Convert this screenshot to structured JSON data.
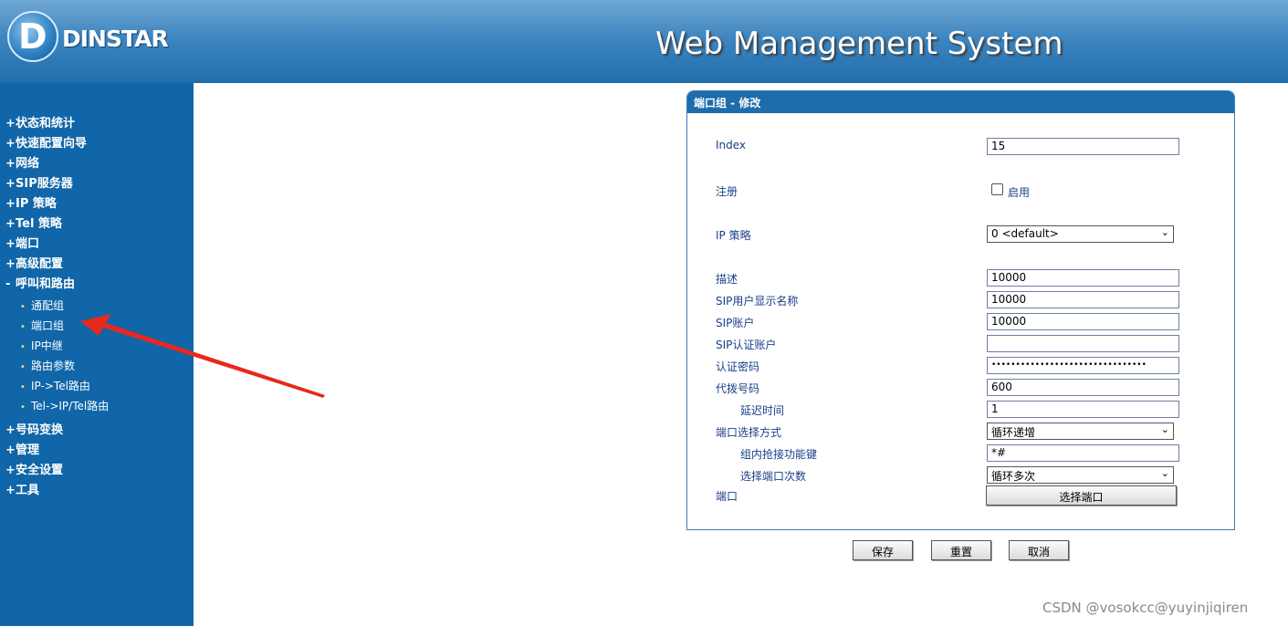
{
  "header": {
    "logo_text": "DINSTAR",
    "logo_mark": "D",
    "system_title": "Web Management System"
  },
  "sidebar": {
    "items": [
      {
        "bullet": "+",
        "label": "状态和统计"
      },
      {
        "bullet": "+",
        "label": "快速配置向导"
      },
      {
        "bullet": "+",
        "label": "网络"
      },
      {
        "bullet": "+",
        "label": "SIP服务器"
      },
      {
        "bullet": "+",
        "label": "IP 策略"
      },
      {
        "bullet": "+",
        "label": "Tel 策略"
      },
      {
        "bullet": "+",
        "label": "端口"
      },
      {
        "bullet": "+",
        "label": "高级配置"
      },
      {
        "bullet": "-",
        "label": "呼叫和路由"
      },
      {
        "bullet": "+",
        "label": "号码变换"
      },
      {
        "bullet": "+",
        "label": "管理"
      },
      {
        "bullet": "+",
        "label": "安全设置"
      },
      {
        "bullet": "+",
        "label": "工具"
      }
    ],
    "sub_items": [
      {
        "label": "通配组"
      },
      {
        "label": "端口组"
      },
      {
        "label": "IP中继"
      },
      {
        "label": "路由参数"
      },
      {
        "label": "IP->Tel路由"
      },
      {
        "label": "Tel->IP/Tel路由"
      }
    ]
  },
  "panel": {
    "title": "端口组 - 修改",
    "fields": {
      "index": {
        "label": "Index",
        "value": "15"
      },
      "register": {
        "label": "注册",
        "checkbox_label": "启用",
        "checked": false
      },
      "ip_profile": {
        "label": "IP 策略",
        "value": "0 <default>"
      },
      "description": {
        "label": "描述",
        "value": "10000"
      },
      "sip_display_name": {
        "label": "SIP用户显示名称",
        "value": "10000"
      },
      "sip_account": {
        "label": "SIP账户",
        "value": "10000"
      },
      "sip_auth_account": {
        "label": "SIP认证账户",
        "value": ""
      },
      "auth_password": {
        "label": "认证密码",
        "value": "••••••••••••••••••••••••••••••••"
      },
      "dial_number": {
        "label": "代拨号码",
        "value": "600"
      },
      "delay_time": {
        "label": "延迟时间",
        "value": "1"
      },
      "port_select_mode": {
        "label": "端口选择方式",
        "value": "循环递增"
      },
      "pickup_key": {
        "label": "组内抢接功能键",
        "value": "*#"
      },
      "port_select_times": {
        "label": "选择端口次数",
        "value": "循环多次"
      },
      "port": {
        "label": "端口",
        "button_label": "选择端口"
      }
    }
  },
  "actions": {
    "save": "保存",
    "reset": "重置",
    "cancel": "取消"
  },
  "watermark": "CSDN @vosokcc@yuyinjiqiren",
  "colors": {
    "sidebar": "#1066a8",
    "panel_header": "#1d6cab",
    "arrow": "#e8281e",
    "label_text": "#1a3f8a"
  }
}
